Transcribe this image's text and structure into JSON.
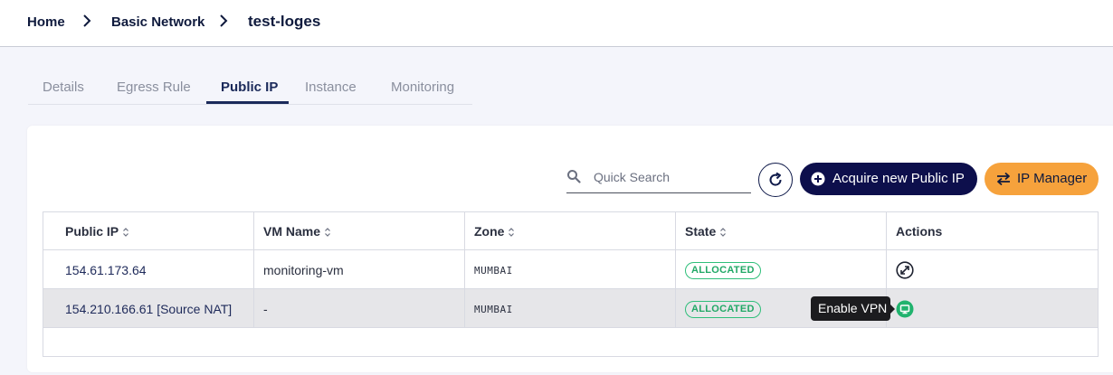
{
  "breadcrumb": {
    "items": [
      "Home",
      "Basic Network",
      "test-loges"
    ]
  },
  "tabs": [
    {
      "label": "Details",
      "active": false
    },
    {
      "label": "Egress Rule",
      "active": false
    },
    {
      "label": "Public IP",
      "active": true
    },
    {
      "label": "Instance",
      "active": false
    },
    {
      "label": "Monitoring",
      "active": false
    }
  ],
  "toolbar": {
    "search_placeholder": "Quick Search",
    "acquire_label": "Acquire new Public IP",
    "ip_manager_label": "IP Manager"
  },
  "table": {
    "columns": [
      "Public IP",
      "VM Name",
      "Zone",
      "State",
      "Actions"
    ],
    "rows": [
      {
        "public_ip": "154.61.173.64",
        "vm_name": "monitoring-vm",
        "zone": "MUMBAI",
        "state": "ALLOCATED",
        "action_icon": "expand-icon"
      },
      {
        "public_ip": "154.210.166.61 [Source NAT]",
        "vm_name": "-",
        "zone": "MUMBAI",
        "state": "ALLOCATED",
        "action_icon": "vpn-icon"
      }
    ]
  },
  "tooltip": {
    "text": "Enable VPN"
  },
  "colors": {
    "primary": "#0d0f4c",
    "accent": "#f6a23c",
    "success": "#21a866"
  }
}
